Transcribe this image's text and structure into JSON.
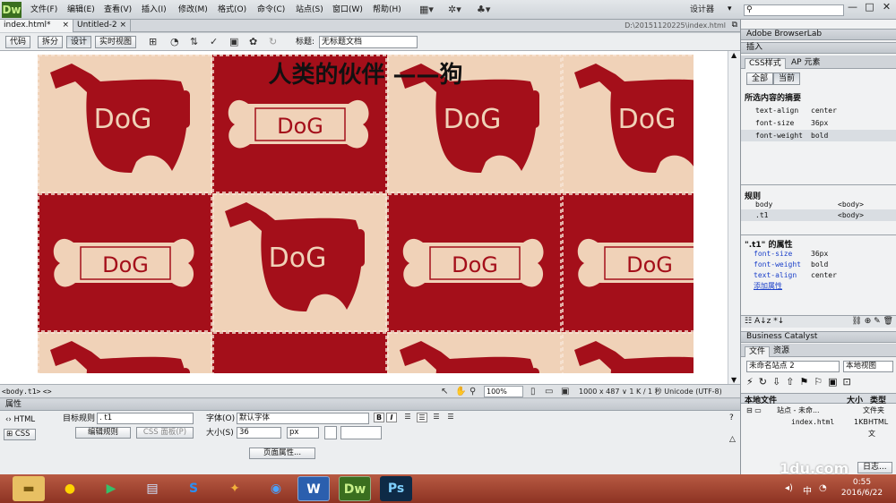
{
  "app": {
    "logo": "Dw",
    "menu": [
      "文件(F)",
      "编辑(E)",
      "查看(V)",
      "插入(I)",
      "修改(M)",
      "格式(O)",
      "命令(C)",
      "站点(S)",
      "窗口(W)",
      "帮助(H)"
    ],
    "workspace": "设计器",
    "window_buttons": [
      "—",
      "□",
      "✕"
    ]
  },
  "doc_tabs": [
    {
      "label": "index.html*",
      "close": "×"
    },
    {
      "label": "Untitled-2",
      "close": "×"
    }
  ],
  "doc_path": "D:\\20151120225\\index.html",
  "view_toolbar": {
    "buttons": [
      "代码",
      "拆分",
      "设计",
      "实时视图"
    ],
    "title_label": "标题:",
    "title_value": "无标题文档"
  },
  "canvas": {
    "heading": "人类的伙伴 ——狗",
    "colors": {
      "cream": "#f0d2b8",
      "red": "#a40f1a"
    },
    "tiles": [
      [
        "dog-cream",
        "bone-red",
        "dog-cream",
        "dog-cream"
      ],
      [
        "bone-red",
        "dog-cream",
        "bone-red",
        "bone-red"
      ],
      [
        "dog-cream",
        "bone-red",
        "dog-cream",
        "dog-cream"
      ]
    ],
    "tile_text": "DoG"
  },
  "status": {
    "tag_selector": "<body.t1>",
    "tag_selector2": "<>",
    "zoom": "100%",
    "dimensions": "1000 x 487 ∨ 1 K / 1 秒 Unicode (UTF-8)"
  },
  "properties": {
    "title": "属性",
    "html_btn": "HTML",
    "css_btn": "CSS",
    "target_rule_label": "目标规则",
    "target_rule": ". t1",
    "edit_rule": "编辑规则",
    "css_panel": "CSS 面板(P)",
    "font_label": "字体(O)",
    "font_value": "默认字体",
    "size_label": "大小(S)",
    "size_value": "36",
    "size_unit": "px",
    "page_props": "页面属性..."
  },
  "right_panel": {
    "browserlab": "Adobe BrowserLab",
    "insert": "插入",
    "css_tab": "CSS样式",
    "ap_tab": "AP 元素",
    "all_btn": "全部",
    "current_btn": "当前",
    "summary_title": "所选内容的摘要",
    "summary": [
      {
        "prop": "text-align",
        "val": "center"
      },
      {
        "prop": "font-size",
        "val": "36px"
      },
      {
        "prop": "font-weight",
        "val": "bold"
      }
    ],
    "rules_title": "规则",
    "rules": [
      {
        "sel": "body",
        "tag": "<body>"
      },
      {
        "sel": ".t1",
        "tag": "<body>"
      }
    ],
    "props_title": "\".t1\" 的属性",
    "props": [
      {
        "prop": "font-size",
        "val": "36px"
      },
      {
        "prop": "font-weight",
        "val": "bold"
      },
      {
        "prop": "text-align",
        "val": "center"
      }
    ],
    "add_prop": "添加属性",
    "business_catalyst": "Business Catalyst",
    "files_tab": "文件",
    "assets_tab": "资源",
    "site_select": "未命名站点 2",
    "view_select": "本地视图",
    "file_header": [
      "本地文件",
      "大小",
      "类型"
    ],
    "site_row": {
      "name": "站点 - 未命...",
      "type": "文件夹"
    },
    "file_row": {
      "name": "index.html",
      "size": "1KB",
      "type": "HTML 文"
    },
    "log_btn": "日志..."
  },
  "taskbar": {
    "apps": [
      "folder",
      "chrome",
      "media",
      "notes",
      "sogou",
      "box",
      "qq-browser",
      "W",
      "Dw",
      "Ps"
    ],
    "tray_lang": "中",
    "time": "0:55",
    "date": "2016/6/22"
  },
  "watermark": "1du.com"
}
